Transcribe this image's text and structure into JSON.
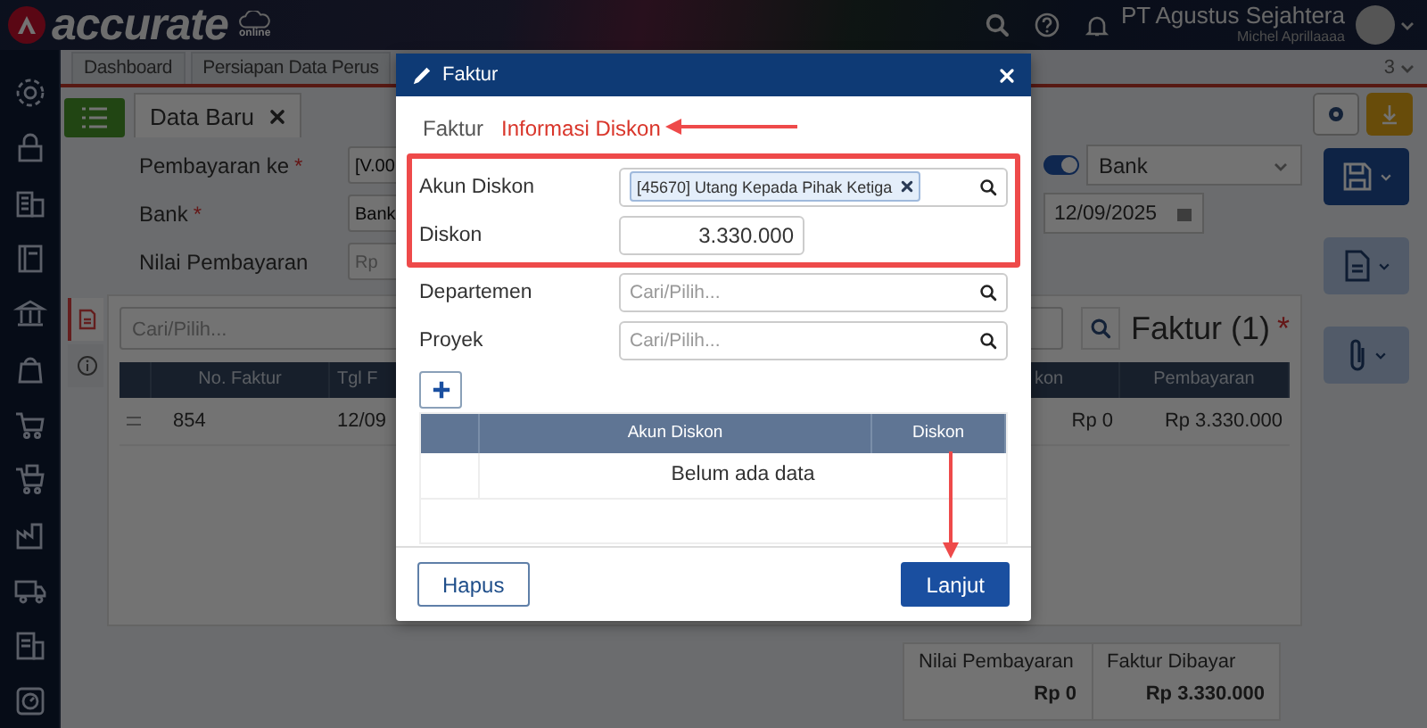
{
  "app": {
    "logo": "accurate",
    "logo_sub": "online",
    "company": "PT Agustus Sejahtera",
    "user": "Michel Aprillaaaa"
  },
  "tabs": [
    {
      "label": "Dashboard",
      "selected": false
    },
    {
      "label": "Persiapan Data Perus",
      "selected": false
    }
  ],
  "tab_count": "3",
  "doc_tab": {
    "label": "Data Baru",
    "selected": true
  },
  "form": {
    "fields": [
      {
        "label": "Pembayaran ke",
        "required_mark": "*",
        "value": "[V.00"
      },
      {
        "label": "Bank",
        "required_mark": "*",
        "value": "Bank"
      },
      {
        "label": "Nilai Pembayaran",
        "placeholder": "Rp"
      }
    ],
    "bank_toggle": {
      "on": true
    },
    "bank_select": "Bank",
    "date": "12/09/2025"
  },
  "invoices": {
    "search_placeholder": "Cari/Pilih...",
    "title": "Faktur (1)",
    "required_mark": "*",
    "columns": [
      "No. Faktur",
      "Tgl F",
      "kon",
      "Pembayaran"
    ],
    "rows": [
      [
        "854",
        "12/09",
        "Rp 0",
        "Rp 3.330.000"
      ]
    ]
  },
  "summary": [
    {
      "label": "Nilai Pembayaran",
      "value": "Rp 0"
    },
    {
      "label": "Faktur Dibayar",
      "value": "Rp 3.330.000"
    }
  ],
  "modal": {
    "title": "Faktur",
    "tabs": [
      {
        "label": "Faktur",
        "selected": false
      },
      {
        "label": "Informasi Diskon",
        "selected": true
      }
    ],
    "fields": [
      {
        "kind": "tags",
        "label": "Akun Diskon",
        "highlighted": true,
        "tags": [
          "[45670] Utang Kepada Pihak Ketiga"
        ]
      },
      {
        "kind": "number",
        "label": "Diskon",
        "highlighted": true,
        "value": "3.330.000"
      },
      {
        "kind": "search",
        "label": "Departemen",
        "highlighted": false,
        "placeholder": "Cari/Pilih..."
      },
      {
        "kind": "search",
        "label": "Proyek",
        "highlighted": false,
        "placeholder": "Cari/Pilih..."
      }
    ],
    "table": {
      "columns": [
        "Akun Diskon",
        "Diskon"
      ],
      "empty_text": "Belum ada data"
    },
    "buttons": [
      {
        "label": "Hapus",
        "kind": "secondary"
      },
      {
        "label": "Lanjut",
        "kind": "primary"
      }
    ]
  }
}
